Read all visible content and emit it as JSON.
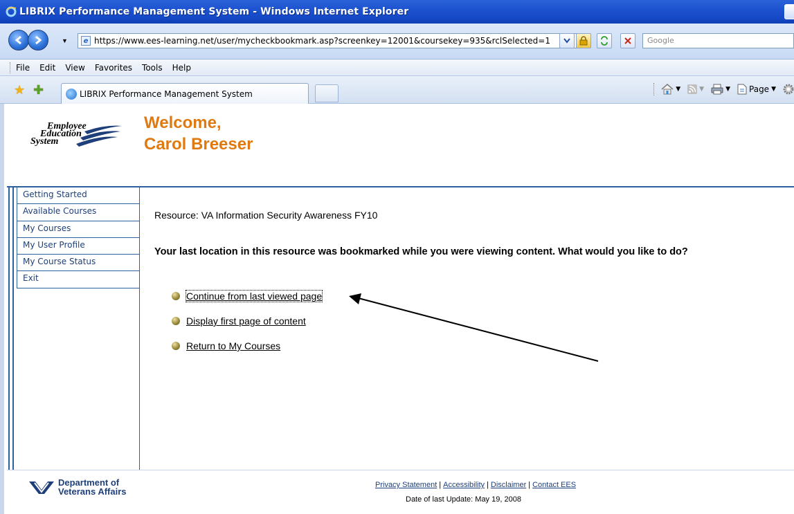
{
  "window": {
    "title": "LIBRIX Performance Management System - Windows Internet Explorer"
  },
  "address": {
    "url": "https://www.ees-learning.net/user/mycheckbookmark.asp?screenkey=12001&coursekey=935&rclSelected=1",
    "search_placeholder": "Google"
  },
  "menu": {
    "items": [
      "File",
      "Edit",
      "View",
      "Favorites",
      "Tools",
      "Help"
    ]
  },
  "tabs": {
    "active_label": "LIBRIX Performance Management System",
    "page_label": "Page"
  },
  "brand": {
    "logo_lines": [
      "Employee",
      "Education",
      "System"
    ],
    "welcome_line1": "Welcome,",
    "welcome_line2": "Carol Breeser",
    "accent_color": "#e07a10",
    "nav_color": "#2c5f9e"
  },
  "sidebar": {
    "items": [
      "Getting Started",
      "Available Courses",
      "My Courses",
      "My User Profile",
      "My Course Status",
      "Exit"
    ]
  },
  "main": {
    "resource_text": "Resource: VA Information Security Awareness FY10",
    "question": "Your last location in this resource was bookmarked while you were viewing content.  What would you like to do?",
    "options": [
      "Continue from last viewed page",
      "Display first page of content",
      "Return to My Courses"
    ]
  },
  "footer": {
    "va_line1": "Department of",
    "va_line2": "Veterans Affairs",
    "links": [
      "Privacy Statement",
      "Accessibility",
      "Disclaimer",
      "Contact EES"
    ],
    "last_update": "Date of last Update: May 19, 2008"
  }
}
